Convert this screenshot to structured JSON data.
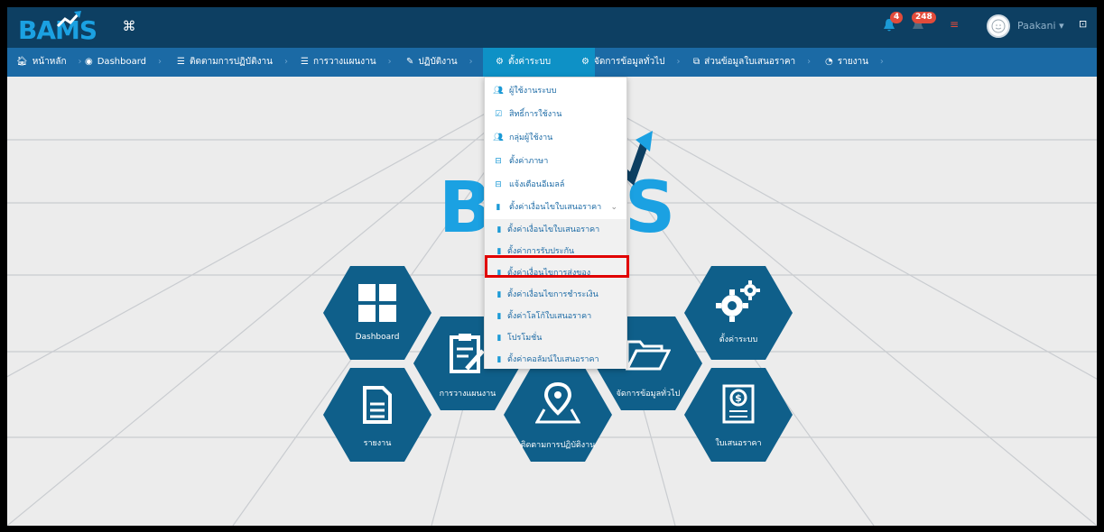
{
  "header": {
    "logo_text": "BAMS",
    "notification_count": "4",
    "message_count": "248",
    "user_name": "Paakani"
  },
  "nav": {
    "items": [
      {
        "label": "หน้าหลัก",
        "icon": "home-icon"
      },
      {
        "label": "Dashboard",
        "icon": "dashboard-icon"
      },
      {
        "label": "ติดตามการปฏิบัติงาน",
        "icon": "list-icon"
      },
      {
        "label": "การวางแผนงาน",
        "icon": "list-icon"
      },
      {
        "label": "ปฏิบัติงาน",
        "icon": "edit-icon"
      },
      {
        "label": "ตั้งค่าระบบ",
        "icon": "gears-icon"
      },
      {
        "label": "จัดการข้อมูลทั่วไป",
        "icon": "gear-icon"
      },
      {
        "label": "ส่วนข้อมูลใบเสนอราคา",
        "icon": "box-icon"
      },
      {
        "label": "รายงาน",
        "icon": "chart-icon"
      }
    ]
  },
  "dropdown": {
    "items": [
      {
        "label": "ผู้ใช้งานระบบ",
        "icon": "users-icon"
      },
      {
        "label": "สิทธิ์การใช้งาน",
        "icon": "check-icon"
      },
      {
        "label": "กลุ่มผู้ใช้งาน",
        "icon": "users-icon"
      },
      {
        "label": "ตั้งค่าภาษา",
        "icon": "db-icon"
      },
      {
        "label": "แจ้งเตือนอีเมลล์",
        "icon": "db-icon"
      },
      {
        "label": "ตั้งค่าเงื่อนไขใบเสนอราคา",
        "icon": "clipboard-icon"
      }
    ],
    "sub_items": [
      {
        "label": "ตั้งค่าเงื่อนไขใบเสนอราคา"
      },
      {
        "label": "ตั้งค่าการรับประกัน"
      },
      {
        "label": "ตั้งค่าเงื่อนไขการส่งของ"
      },
      {
        "label": "ตั้งค่าเงื่อนไขการชำระเงิน"
      },
      {
        "label": "ตั้งค่าโลโก้ใบเสนอราคา"
      },
      {
        "label": "โปรโมชั่น"
      },
      {
        "label": "ตั้งค่าคอลัมน์ใบเสนอราคา"
      }
    ]
  },
  "hexes": {
    "dashboard": "Dashboard",
    "planning": "การวางแผนงาน",
    "general_data": "จัดการข้อมูลทั่วไป",
    "settings": "ตั้งค่าระบบ",
    "report": "รายงาน",
    "tracking": "ติดตามการปฏิบัติงาน",
    "quotation": "ใบเสนอราคา"
  },
  "colors": {
    "header_bg": "#0d3f62",
    "nav_bg": "#1b6aa5",
    "nav_active": "#0e91c6",
    "hex_bg": "#0f5f8a",
    "brand": "#1ba1e2",
    "highlight": "#e10000"
  }
}
